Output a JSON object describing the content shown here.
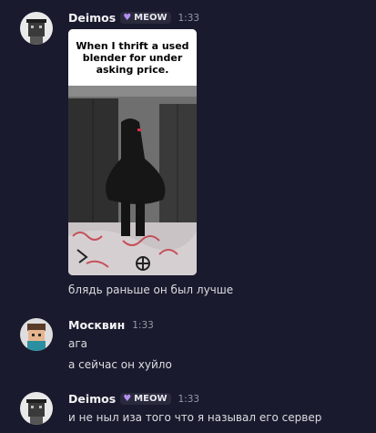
{
  "messages": [
    {
      "author": "Deimos",
      "tag": "MEOW",
      "time": "1:33",
      "meme_caption": "When I thrift a used blender for under asking price.",
      "text": "блядь раньше он был лучше"
    },
    {
      "author": "Москвин",
      "time": "1:33",
      "lines": [
        "ага",
        "а сейчас он хуйло"
      ]
    },
    {
      "author": "Deimos",
      "tag": "MEOW",
      "time": "1:33",
      "text": "и не ныл иза того что я называл его сервер"
    }
  ],
  "colors": {
    "background": "#1a1a2e",
    "author": "#f2f3f5",
    "text": "#dbdee1",
    "timestamp": "#949ba4",
    "tag_heart": "#b48ef0"
  },
  "icons": [
    "avatar-deimos",
    "avatar-moskvin",
    "purple-heart-icon"
  ]
}
